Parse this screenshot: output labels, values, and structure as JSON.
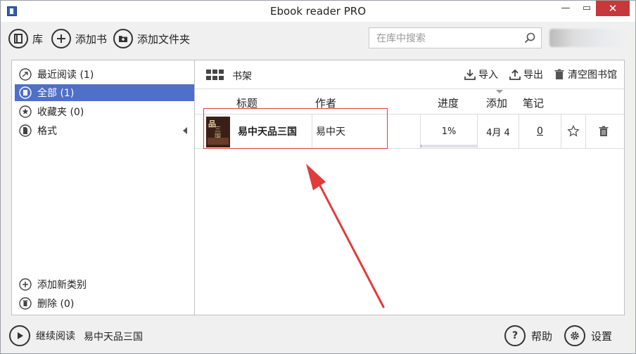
{
  "window": {
    "title": "Ebook reader PRO",
    "minimize": "—",
    "maximize": "▭",
    "close": "✕"
  },
  "toolbar": {
    "library_label": "库",
    "add_book_label": "添加书",
    "add_folder_label": "添加文件夹",
    "search_placeholder": "在库中搜索"
  },
  "sidebar": {
    "items": [
      {
        "label": "最近阅读 (1)",
        "icon": "recent-icon",
        "selected": false
      },
      {
        "label": "全部 (1)",
        "icon": "book-icon",
        "selected": true
      },
      {
        "label": "收藏夹 (0)",
        "icon": "star-icon",
        "selected": false
      },
      {
        "label": "格式",
        "icon": "file-icon",
        "selected": false
      }
    ],
    "add_category": "添加新类别",
    "deleted": "删除 (0)"
  },
  "main": {
    "view_label": "书架",
    "actions": {
      "import": "导入",
      "export": "导出",
      "clear": "清空图书馆"
    },
    "columns": {
      "title": "标题",
      "author": "作者",
      "progress": "进度",
      "added": "添加",
      "notes": "笔记"
    },
    "books": [
      {
        "title": "易中天品三国",
        "author": "易中天",
        "progress": "1%",
        "progress_fraction": 0.01,
        "added": "4月 4",
        "notes": "0",
        "cover_text_top": "品",
        "cover_text_side": "三国"
      }
    ]
  },
  "bottom": {
    "continue_label": "继续阅读",
    "current_book": "易中天品三国",
    "help_label": "帮助",
    "settings_label": "设置"
  },
  "colors": {
    "accent": "#4f6fc8",
    "annotation": "#e03c3c",
    "close_button": "#c7383a"
  }
}
